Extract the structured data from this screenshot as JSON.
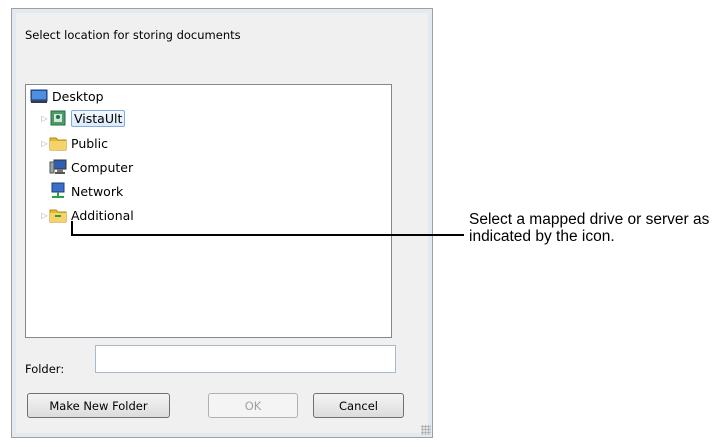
{
  "dialog": {
    "prompt": "Select location for storing documents",
    "tree": [
      {
        "label": "Desktop",
        "icon": "desktop-icon",
        "expandable": false,
        "selected": false
      },
      {
        "label": "VistaUlt",
        "icon": "user-folder-icon",
        "expandable": true,
        "selected": true
      },
      {
        "label": "Public",
        "icon": "folder-icon",
        "expandable": true,
        "selected": false
      },
      {
        "label": "Computer",
        "icon": "computer-icon",
        "expandable": false,
        "selected": false
      },
      {
        "label": "Network",
        "icon": "network-icon",
        "expandable": false,
        "selected": false
      },
      {
        "label": "Additional",
        "icon": "network-drive-icon",
        "expandable": true,
        "selected": false
      }
    ],
    "folder_label": "Folder:",
    "folder_value": "",
    "buttons": {
      "make_new_folder": "Make New Folder",
      "ok": "OK",
      "cancel": "Cancel"
    }
  },
  "callout": {
    "text": "Select a mapped drive or server as indicated by the icon."
  },
  "colors": {
    "selection_border": "#84acdd",
    "folder_yellow": "#e8b830"
  }
}
